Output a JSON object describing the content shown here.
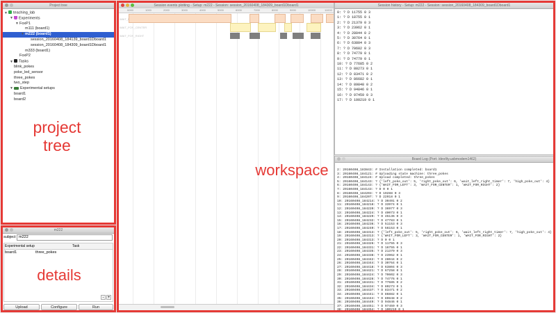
{
  "project_tree": {
    "title": "Project tree",
    "items": [
      {
        "label": "teaching_lab",
        "indent": 0,
        "arrow": "▼",
        "icon": "green"
      },
      {
        "label": "Experiments",
        "indent": 1,
        "arrow": "▼",
        "icon": "flask"
      },
      {
        "label": "FoxP1",
        "indent": 2,
        "arrow": "▼",
        "icon": ""
      },
      {
        "label": "m111 (board1)",
        "indent": 3,
        "arrow": "",
        "icon": ""
      },
      {
        "label": "m222 (board1)",
        "indent": 3,
        "arrow": "▼",
        "icon": "",
        "selected": true
      },
      {
        "label": "session_20160408_184139_board1Dboard1",
        "indent": 4,
        "arrow": "",
        "icon": ""
      },
      {
        "label": "session_20160408_184309_board1Dboard1",
        "indent": 4,
        "arrow": "",
        "icon": ""
      },
      {
        "label": "m333 (board1)",
        "indent": 3,
        "arrow": "",
        "icon": ""
      },
      {
        "label": "FoxP2",
        "indent": 2,
        "arrow": "",
        "icon": ""
      },
      {
        "label": "Tasks",
        "indent": 1,
        "arrow": "▼",
        "icon": "camera"
      },
      {
        "label": "blink_pokes",
        "indent": 1,
        "arrow": "",
        "icon": ""
      },
      {
        "label": "poke_led_sensor",
        "indent": 1,
        "arrow": "",
        "icon": ""
      },
      {
        "label": "three_pokes",
        "indent": 1,
        "arrow": "",
        "icon": ""
      },
      {
        "label": "two_step",
        "indent": 1,
        "arrow": "",
        "icon": ""
      },
      {
        "label": "Experimental setups",
        "indent": 1,
        "arrow": "▼",
        "icon": "setup"
      },
      {
        "label": "board1",
        "indent": 1,
        "arrow": "",
        "icon": ""
      },
      {
        "label": "board2",
        "indent": 1,
        "arrow": "",
        "icon": ""
      }
    ]
  },
  "details": {
    "title": "m222",
    "subject_label": "subject",
    "subject_value": "m222",
    "col_setup": "Experimental setup",
    "col_task": "Task",
    "row_setup": "board1",
    "row_task": "three_pokes",
    "btn_minus": "-",
    "btn_plus": "+",
    "upload": "Upload",
    "configure": "Configure",
    "run": "Run"
  },
  "session_plot": {
    "title": "Session events plotting - Setup: m222 - Session: session_20160408_184309_board1Dboard1",
    "axis_ticks": [
      "0000",
      "1000",
      "2000",
      "3000",
      "4000",
      "5000",
      "6000",
      "7000",
      "8000",
      "9000",
      "10000",
      "11000"
    ],
    "row_labels": [
      "WAIT_FOR_LEFT",
      "WAIT_FOR_CENTER",
      "WAIT_FOR_RIGHT"
    ]
  },
  "session_history": {
    "title": "Session history - Setup: m222 - Session: session_20160408_184309_board1Dboard1",
    "lines": [
      "0: ? D 11755 0 3",
      "1: ? D 18755 0 1",
      "2: ? D 21379 0 3",
      "3: ? D 23962 0 1",
      "4: ? D 28044 0 2",
      "5: ? D 30764 0 1",
      "6: ? D 63804 0 3",
      "7: ? D 70602 0 3",
      "8: ? D 74779 0 1",
      "9: ? D 74779 0 1",
      "10: ? D 77685 0 2",
      "11: ? D 80273 0 1",
      "12: ? D 83471 0 2",
      "13: ? D 86682 0 1",
      "14: ? D 89848 0 2",
      "15: ? D 94846 0 1",
      "16: ? D 97459 0 3",
      "17: ? D 100219 0 1"
    ]
  },
  "board_log": {
    "title": "Board Log (Port: /dev/tty.usbmodem1462)",
    "lines": [
      "2: 20160408_183843: # Installation completed: board1",
      "3: 20160408_184121: # Uploading state machine: three_pokes",
      "4: 20160408_184124: # Upload completed: three_pokes",
      "5: 20160408_184143: ? {'left_poke_out': 5, 'right_poke_out': 6, 'wait_left_right_timer': 7, 'high_poke_out': 4}",
      "6: 20160408_184143: ? {'WAIT_FOR_LEFT': 3, 'WAIT_FOR_CENTER': 1, 'WAIT_FOR_RIGHT': 2}",
      "7: 20160408_184143: ? D 0 0 1",
      "8: 20160408_184203: ? D 19288 0 3",
      "9: 20160408_184207: ? D 22918 0 1",
      "10: 20160408_184214: ? D 30491 0 2",
      "11: 20160408_184218: ? D 33974 0 1",
      "12: 20160408_184220: ? D 36977 0 3",
      "13: 20160408_184224: ? D 40073 0 1",
      "14: 20160408_184229: ? D 45136 0 3",
      "15: 20160408_184232: ? D 47783 0 1",
      "16: 20160408_184236: ? D 51153 0 3",
      "17: 20160408_184240: ? D 56153 0 1",
      "18: 20160408_184313: ? {'left_poke_out': 5, 'right_poke_out': 6, 'wait_left_right_timer': 7, 'high_poke_out': 4}",
      "19: 20160408_184313: ? {'WAIT_FOR_LEFT': 3, 'WAIT_FOR_CENTER': 1, 'WAIT_FOR_RIGHT': 2}",
      "20: 20160408_184313: ? D 0 0 1",
      "21: 20160408_184326: ? D 11755 0 3",
      "22: 20160408_184331: ? D 16755 0 1",
      "23: 20160408_184335: ? D 21379 0 3",
      "24: 20160408_184338: ? D 23962 0 1",
      "25: 20160408_184342: ? D 28044 0 2",
      "26: 20160408_184344: ? D 30764 0 1",
      "27: 20160408_184418: ? D 63804 0 3",
      "28: 20160408_184421: ? D 67258 0 1",
      "29: 20160408_184424: ? D 70602 0 3",
      "30: 20160408_184428: ? D 74776 0 1",
      "31: 20160408_184431: ? D 77685 0 2",
      "32: 20160408_184434: ? D 80273 0 1",
      "33: 20160408_184437: ? D 83471 0 2",
      "34: 20160408_184441: ? D 86882 0 1",
      "35: 20160408_184444: ? D 89848 0 2",
      "36: 20160408_184449: ? D 94846 0 1",
      "37: 20160408_184451: ? D 97459 0 3",
      "38: 20160408_184454: ? D 100219 0 1"
    ]
  },
  "annotations": {
    "project_tree": "project\ntree",
    "details": "details",
    "workspace": "workspace"
  },
  "colors": {
    "highlight": "#e53935",
    "selection": "#2f5fd0",
    "plot_orange": "#fbdcc3",
    "plot_yellow": "#fdf3bf",
    "plot_gray": "#7f7f7f"
  }
}
